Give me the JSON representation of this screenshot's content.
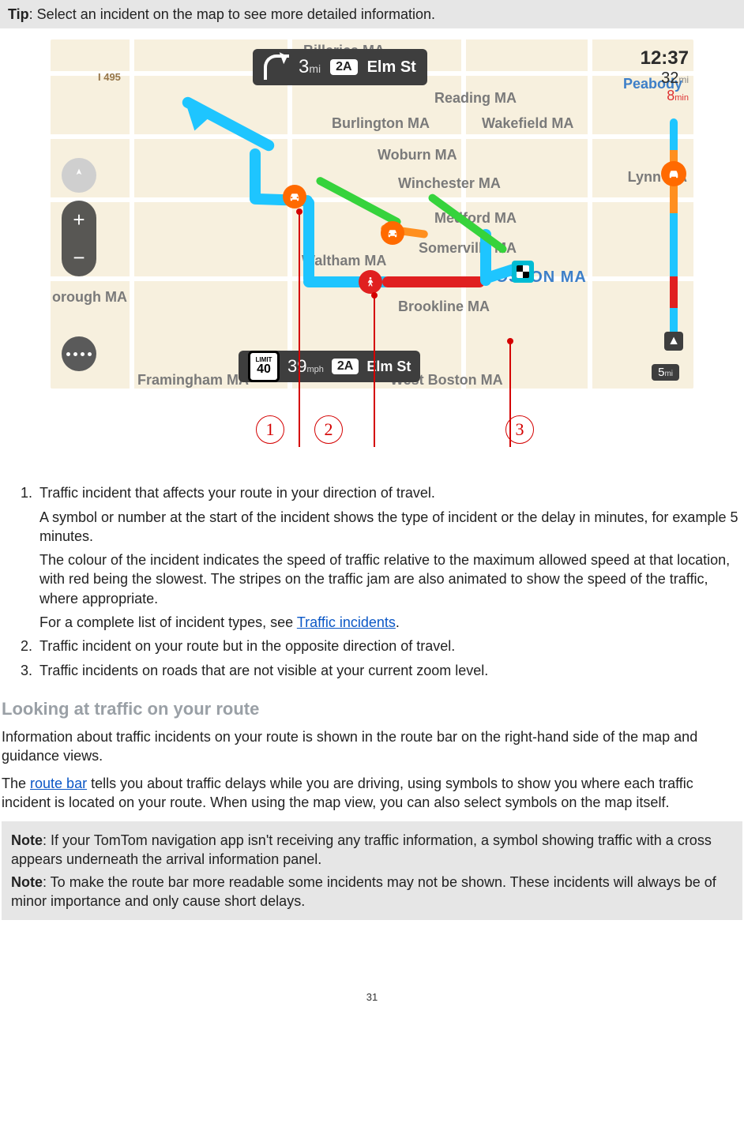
{
  "tip": {
    "label": "Tip",
    "text": ": Select an incident on the map to see more detailed information."
  },
  "map": {
    "instruction": {
      "distance": "3",
      "distance_unit": "mi",
      "road_ref": "2A",
      "road_name": "Elm St"
    },
    "arrival": {
      "time": "12:37",
      "remaining_distance": "32",
      "remaining_distance_unit": "mi",
      "delay": "8",
      "delay_unit": "min"
    },
    "routebar": {
      "remaining": "5",
      "remaining_unit": "mi"
    },
    "speed": {
      "limit_word": "LIMIT",
      "limit": "40",
      "current": "39",
      "current_unit": "mph",
      "road_ref": "2A",
      "road_name": "Elm St"
    },
    "towns": {
      "billerica": "Billerica MA",
      "reading": "Reading MA",
      "burlington": "Burlington MA",
      "wakefield": "Wakefield MA",
      "woburn": "Woburn MA",
      "winchester": "Winchester MA",
      "lynn": "Lynn MA",
      "medford": "Medford MA",
      "somerville": "Somerville MA",
      "waltham": "Waltham MA",
      "brookline": "Brookline MA",
      "orough": "orough MA",
      "peabody": "Peabody",
      "boston": "BOSTON MA",
      "framingham": "Framingham MA",
      "west": "West Boston MA",
      "i495": "I 495"
    },
    "callouts": {
      "c1": "1",
      "c2": "2",
      "c3": "3"
    }
  },
  "list": {
    "i1": {
      "title": "Traffic incident that affects your route in your direction of travel.",
      "p1": "A symbol or number at the start of the incident shows the type of incident or the delay in minutes, for example 5 minutes.",
      "p2": "The colour of the incident indicates the speed of traffic relative to the maximum allowed speed at that location, with red being the slowest. The stripes on the traffic jam are also animated to show the speed of the traffic, where appropriate.",
      "p3_a": "For a complete list of incident types, see ",
      "p3_link": "Traffic incidents",
      "p3_b": "."
    },
    "i2": "Traffic incident on your route but in the opposite direction of travel.",
    "i3": "Traffic incidents on roads that are not visible at your current zoom level."
  },
  "section_heading": "Looking at traffic on your route",
  "para1": "Information about traffic incidents on your route is shown in the route bar on the right-hand side of the map and guidance views.",
  "para2_a": "The ",
  "para2_link": "route bar",
  "para2_b": " tells you about traffic delays while you are driving, using symbols to show you where each traffic incident is located on your route. When using the map view, you can also select symbols on the map itself.",
  "notes": {
    "label": "Note",
    "n1": ": If your TomTom navigation app isn't receiving any traffic information, a symbol showing traffic with a cross appears underneath the arrival information panel.",
    "n2": ": To make the route bar more readable some incidents may not be shown. These incidents will always be of minor importance and only cause short delays."
  },
  "page_number": "31"
}
